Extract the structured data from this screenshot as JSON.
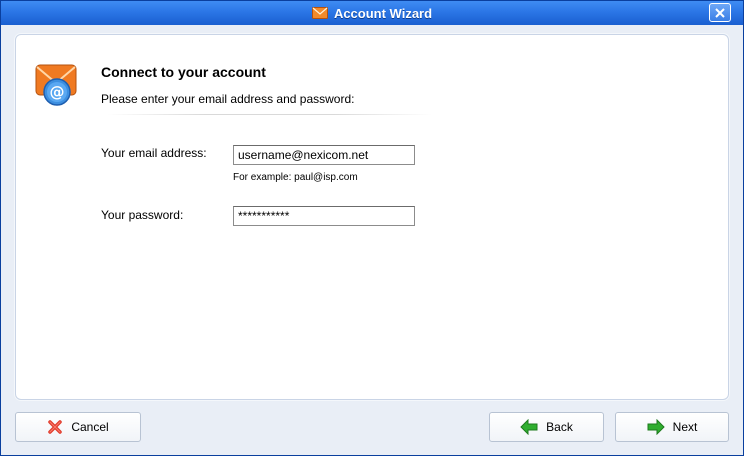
{
  "window": {
    "title": "Account Wizard",
    "title_icon": "envelope-icon",
    "close_icon": "close-icon"
  },
  "page": {
    "heading": "Connect to your account",
    "subheading": "Please enter your email address and password:",
    "icon": "email-at-icon"
  },
  "form": {
    "email_label": "Your email address:",
    "email_value": "username@nexicom.net",
    "email_hint": "For example: paul@isp.com",
    "password_label": "Your password:",
    "password_value": "***********"
  },
  "buttons": {
    "cancel": "Cancel",
    "back": "Back",
    "next": "Next"
  },
  "colors": {
    "title_bar": "#2b76e6",
    "cancel_icon": "#e03a2a",
    "arrow_icon": "#2fae2f"
  }
}
